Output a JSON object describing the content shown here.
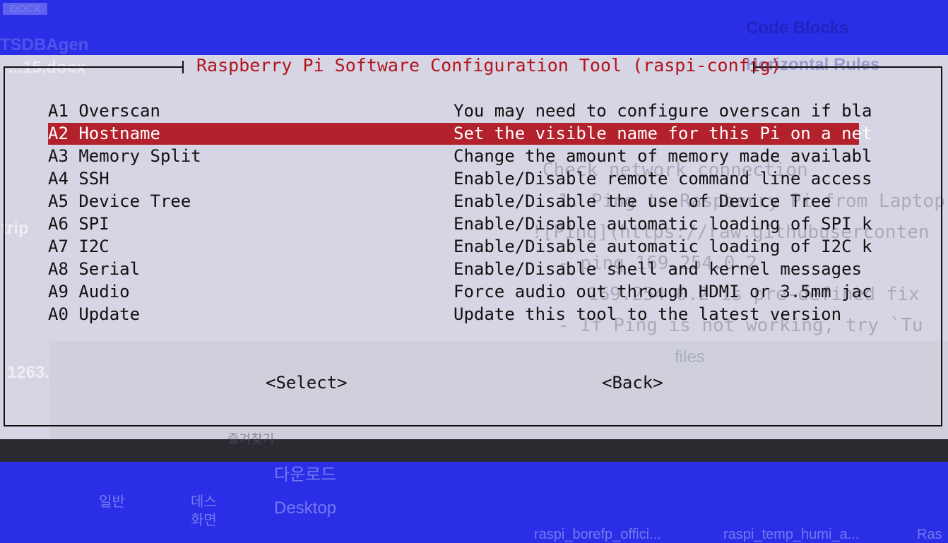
{
  "background": {
    "top_left_file": "DOCX",
    "top_left_app": "TSDBAgen",
    "doc_name": "...15.docx",
    "side_label_1": "trip",
    "side_label_2": "1263.",
    "code_blocks": "Code Blocks",
    "horizontal_rules": "Horizontal Rules",
    "lines": [
      "Check network connection",
      "1. Ping to Raspberry Pi from Laptop",
      "![Ping](https://raw.githubuserconten",
      "- ping 169.254.0.2",
      "169.254.0.2 is pre-defined fix",
      "- If Ping is not working, try `Tu"
    ],
    "finder_folder": "files",
    "favorites": "즐겨찾기",
    "downloads": "다운로드",
    "desktop": "Desktop",
    "icon_general": "일반",
    "icon_desktop_1": "데스",
    "icon_desktop_2": "화면",
    "file_1": "raspi_borefp_offici...",
    "file_2": "raspi_temp_humi_a...",
    "file_3": "Ras"
  },
  "dialog": {
    "title": "Raspberry Pi Software Configuration Tool (raspi-config)",
    "selected_index": 1,
    "items": [
      {
        "label": "A1 Overscan",
        "desc": "You may need to configure overscan if bla"
      },
      {
        "label": "A2 Hostname",
        "desc": "Set the visible name for this Pi on a net"
      },
      {
        "label": "A3 Memory Split",
        "desc": "Change the amount of memory made availabl"
      },
      {
        "label": "A4 SSH",
        "desc": "Enable/Disable remote command line access"
      },
      {
        "label": "A5 Device Tree",
        "desc": "Enable/Disable the use of Device Tree"
      },
      {
        "label": "A6 SPI",
        "desc": "Enable/Disable automatic loading of SPI k"
      },
      {
        "label": "A7 I2C",
        "desc": "Enable/Disable automatic loading of I2C k"
      },
      {
        "label": "A8 Serial",
        "desc": "Enable/Disable shell and kernel messages"
      },
      {
        "label": "A9 Audio",
        "desc": "Force audio out through HDMI or 3.5mm jac"
      },
      {
        "label": "A0 Update",
        "desc": "Update this tool to the latest version"
      }
    ],
    "select_button": "<Select>",
    "back_button": "<Back>"
  },
  "colors": {
    "desktop_blue": "#2a2ee6",
    "title_red": "#b3141e",
    "highlight_red": "#b3222c"
  }
}
